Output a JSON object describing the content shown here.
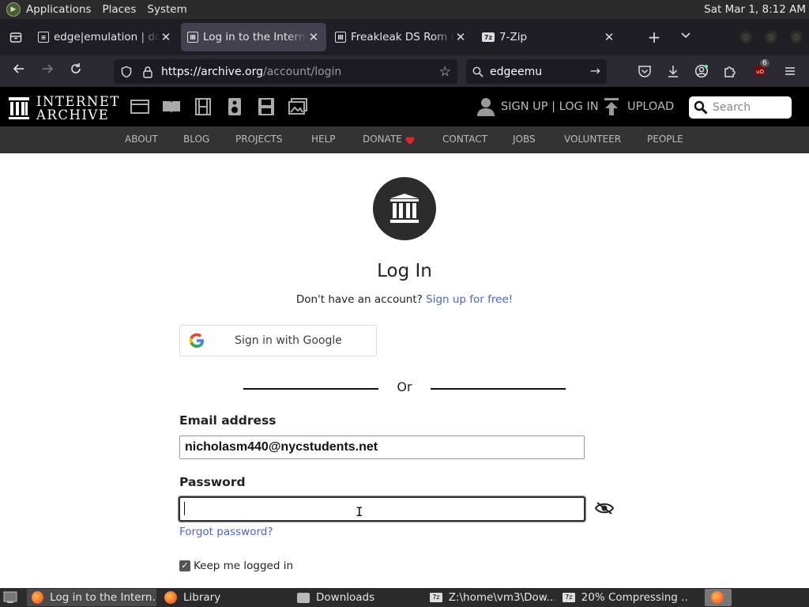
{
  "system_panel": {
    "menus": [
      "Applications",
      "Places",
      "System"
    ],
    "clock": "Sat Mar 1,  8:12 AM"
  },
  "browser": {
    "tabs": [
      {
        "title": "edge|emulation | down",
        "favicon": "document-icon",
        "active": false
      },
      {
        "title": "Log in to the Internet A",
        "favicon": "archive-icon",
        "active": true
      },
      {
        "title": "Freakleak DS Rom Coll",
        "favicon": "archive-icon",
        "active": false
      },
      {
        "title": "7-Zip",
        "favicon": "7zip-icon",
        "active": false
      }
    ],
    "url_base": "https://archive.org",
    "url_path": "/account/login",
    "search_query": "edgeemu",
    "extension_badge": "6"
  },
  "ia_header": {
    "logo_line1": "INTERNET",
    "logo_line2": "ARCHIVE",
    "signup_login": "SIGN UP | LOG IN",
    "upload": "UPLOAD",
    "search_placeholder": "Search",
    "subnav": [
      "ABOUT",
      "BLOG",
      "PROJECTS",
      "HELP",
      "DONATE",
      "CONTACT",
      "JOBS",
      "VOLUNTEER",
      "PEOPLE"
    ]
  },
  "login": {
    "title": "Log In",
    "no_account_text": "Don't have an account?",
    "signup_link": "Sign up for free!",
    "google_button": "Sign in with Google",
    "or_text": "Or",
    "email_label": "Email address",
    "email_value": "nicholasm440@nycstudents.net",
    "password_label": "Password",
    "password_value": "",
    "forgot_password": "Forgot password?",
    "keep_logged_in": "Keep me logged in",
    "keep_logged_in_checked": true
  },
  "taskbar": {
    "items": [
      {
        "title": "Log in to the Intern...",
        "icon": "firefox-icon",
        "active": true
      },
      {
        "title": "Library",
        "icon": "firefox-icon",
        "active": false
      },
      {
        "title": "Downloads",
        "icon": "folder-icon",
        "active": false
      },
      {
        "title": "Z:\\home\\vm3\\Dow...",
        "icon": "7zip-icon",
        "active": false
      },
      {
        "title": "20% Compressing ...",
        "icon": "7zip-icon",
        "active": false
      }
    ]
  },
  "colors": {
    "link_blue": "#4b64d7",
    "ia_black": "#000000",
    "ia_subnav": "#333333",
    "donate_heart": "#e0262d"
  }
}
